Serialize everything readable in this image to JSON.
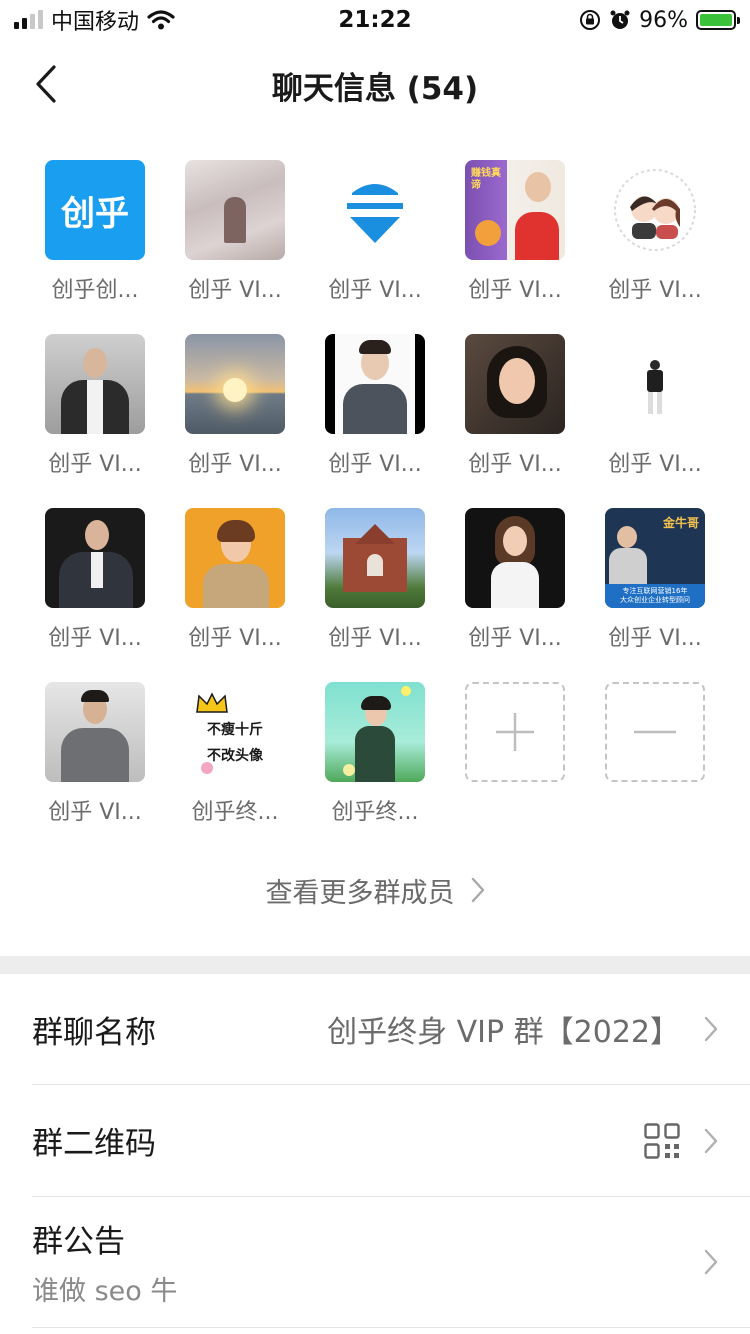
{
  "status_bar": {
    "carrier": "中国移动",
    "time": "21:22",
    "battery": "96%"
  },
  "nav": {
    "title": "聊天信息 (54)"
  },
  "members": [
    {
      "name": "创乎创..."
    },
    {
      "name": "创乎 VI..."
    },
    {
      "name": "创乎 VI..."
    },
    {
      "name": "创乎 VI..."
    },
    {
      "name": "创乎 VI..."
    },
    {
      "name": "创乎 VI..."
    },
    {
      "name": "创乎 VI..."
    },
    {
      "name": "创乎 VI..."
    },
    {
      "name": "创乎 VI..."
    },
    {
      "name": "创乎 VI..."
    },
    {
      "name": "创乎 VI..."
    },
    {
      "name": "创乎 VI..."
    },
    {
      "name": "创乎 VI..."
    },
    {
      "name": "创乎 VI..."
    },
    {
      "name": "创乎 VI..."
    },
    {
      "name": "创乎 VI..."
    },
    {
      "name": "创乎终..."
    },
    {
      "name": "创乎终..."
    }
  ],
  "avatar_texts": {
    "logo": "创乎",
    "book_title": "赚钱真谛",
    "crown_line1": "不瘦十斤",
    "crown_line2": "不改头像",
    "poster_name": "金牛哥",
    "poster_line1": "专注互联网营销16年",
    "poster_line2": "大众创业企业转型顾问"
  },
  "view_more": "查看更多群成员",
  "settings": {
    "group_name_label": "群聊名称",
    "group_name_value": "创乎终身 VIP 群【2022】",
    "qr_label": "群二维码",
    "notice_label": "群公告",
    "notice_value": "谁做 seo 牛"
  },
  "colors": {
    "brand_blue": "#1a9ef0",
    "charging_green": "#3cc13b"
  }
}
